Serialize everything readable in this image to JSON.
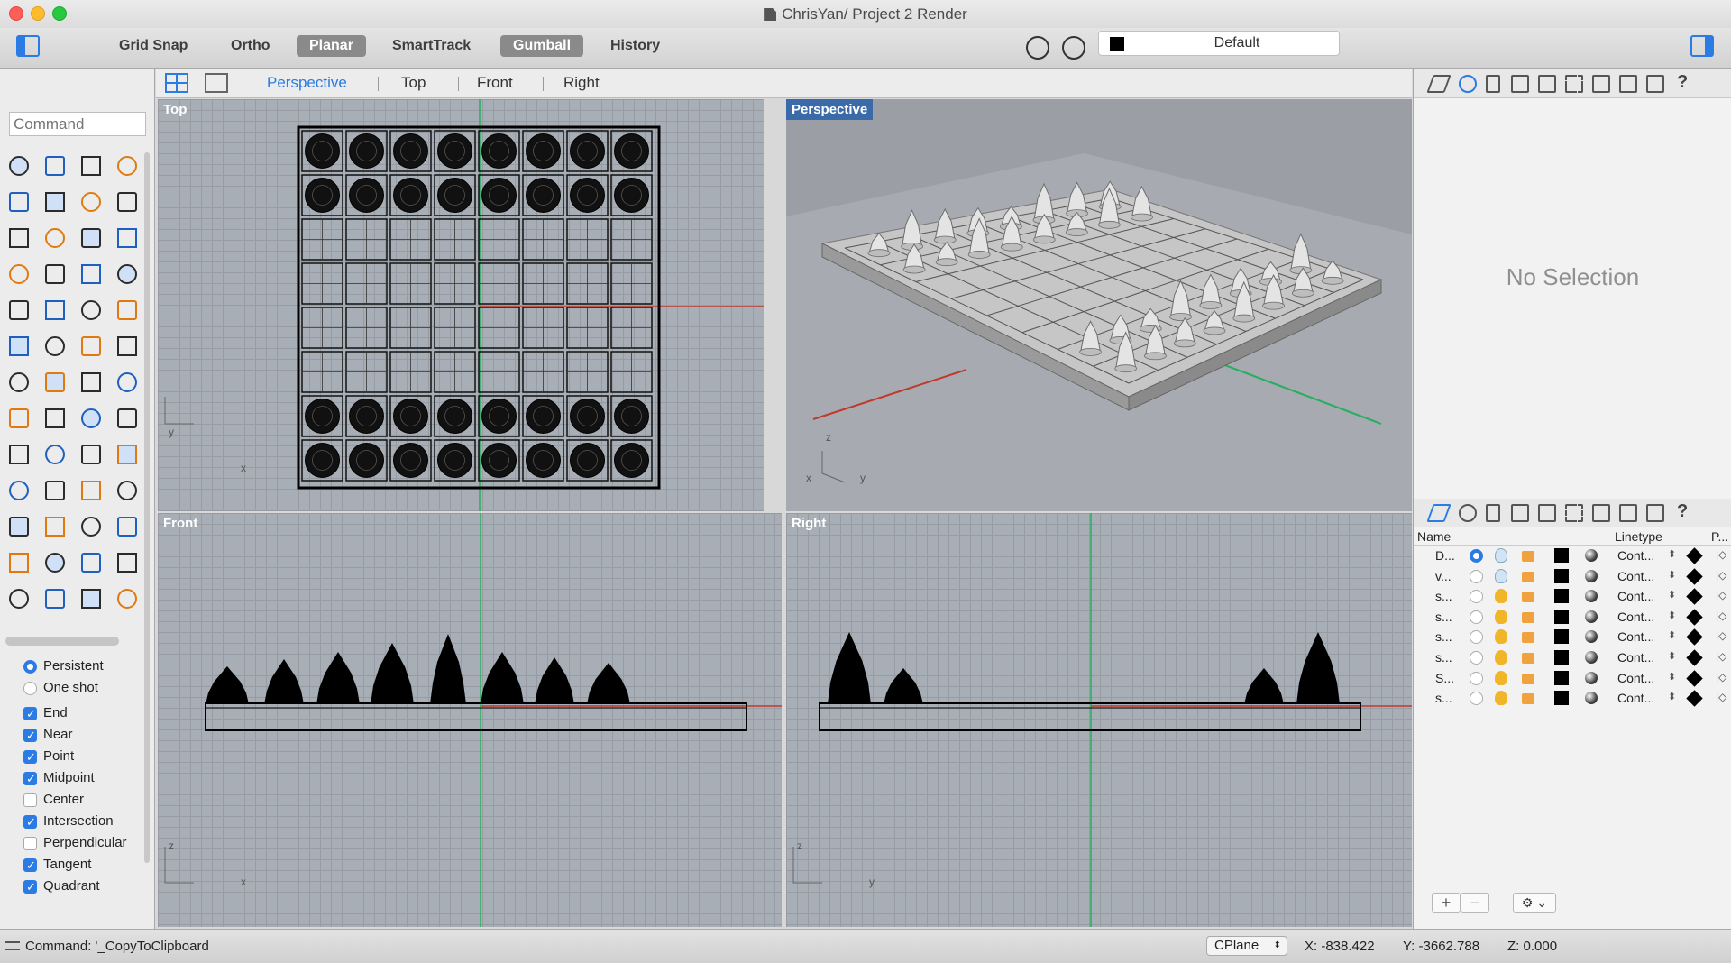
{
  "window": {
    "title": "ChrisYan/ Project 2 Render"
  },
  "toolbar": {
    "buttons": [
      {
        "label": "Grid Snap",
        "active": false
      },
      {
        "label": "Ortho",
        "active": false
      },
      {
        "label": "Planar",
        "active": true
      },
      {
        "label": "SmartTrack",
        "active": false
      },
      {
        "label": "Gumball",
        "active": true
      },
      {
        "label": "History",
        "active": false
      }
    ],
    "layer": "Default"
  },
  "viewport_tabs": [
    "Perspective",
    "Top",
    "Front",
    "Right"
  ],
  "viewports": {
    "top": "Top",
    "perspective": "Perspective",
    "front": "Front",
    "right": "Right"
  },
  "command": {
    "placeholder": "Command"
  },
  "osnap": {
    "modes": [
      {
        "label": "Persistent",
        "on": true
      },
      {
        "label": "One shot",
        "on": false
      }
    ],
    "items": [
      {
        "label": "End",
        "on": true
      },
      {
        "label": "Near",
        "on": true
      },
      {
        "label": "Point",
        "on": true
      },
      {
        "label": "Midpoint",
        "on": true
      },
      {
        "label": "Center",
        "on": false
      },
      {
        "label": "Intersection",
        "on": true
      },
      {
        "label": "Perpendicular",
        "on": false
      },
      {
        "label": "Tangent",
        "on": true
      },
      {
        "label": "Quadrant",
        "on": true
      }
    ]
  },
  "properties": {
    "empty_text": "No Selection"
  },
  "layers": {
    "headers": {
      "name": "Name",
      "linetype": "Linetype",
      "print": "P..."
    },
    "rows": [
      {
        "name": "D...",
        "current": true,
        "light_on": false,
        "linetype": "Cont..."
      },
      {
        "name": "v...",
        "current": false,
        "light_on": false,
        "linetype": "Cont..."
      },
      {
        "name": "s...",
        "current": false,
        "light_on": true,
        "linetype": "Cont..."
      },
      {
        "name": "s...",
        "current": false,
        "light_on": true,
        "linetype": "Cont..."
      },
      {
        "name": "s...",
        "current": false,
        "light_on": true,
        "linetype": "Cont..."
      },
      {
        "name": "s...",
        "current": false,
        "light_on": true,
        "linetype": "Cont..."
      },
      {
        "name": "S...",
        "current": false,
        "light_on": true,
        "linetype": "Cont..."
      },
      {
        "name": "s...",
        "current": false,
        "light_on": true,
        "linetype": "Cont..."
      }
    ]
  },
  "status": {
    "command": "Command: '_CopyToClipboard",
    "cplane": "CPlane",
    "x": "X: -838.422",
    "y": "Y: -3662.788",
    "z": "Z: 0.000"
  },
  "axes": {
    "x": "x",
    "y": "y",
    "z": "z"
  },
  "colors": {
    "accent": "#2a7be4",
    "x_axis": "#c0392b",
    "y_axis": "#27ae60"
  }
}
